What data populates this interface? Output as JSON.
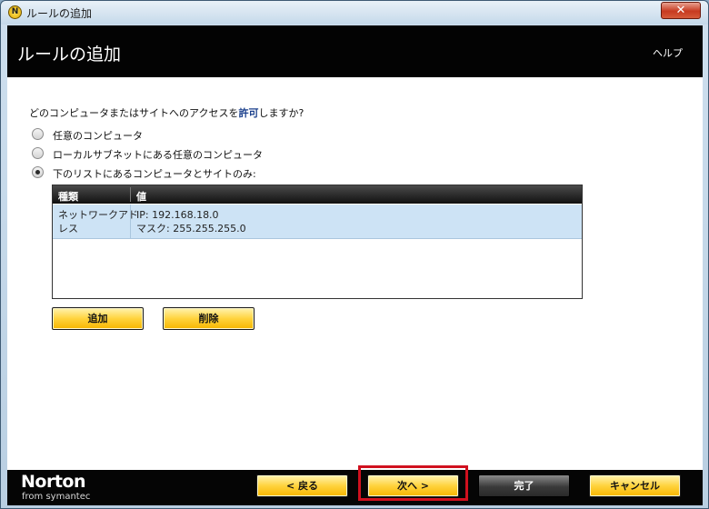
{
  "window": {
    "title": "ルールの追加",
    "app_icon_glyph": "N",
    "close_glyph": "✕"
  },
  "header": {
    "title": "ルールの追加",
    "help": "ヘルプ"
  },
  "question": {
    "prefix": "どのコンピュータまたはサイトへのアクセスを",
    "emphasis": "許可",
    "suffix": "しますか?"
  },
  "options": [
    {
      "label": "任意のコンピュータ",
      "checked": false
    },
    {
      "label": "ローカルサブネットにある任意のコンピュータ",
      "checked": false
    },
    {
      "label": "下のリストにあるコンピュータとサイトのみ:",
      "checked": true
    }
  ],
  "table": {
    "columns": [
      "種類",
      "値"
    ],
    "rows": [
      {
        "type_line1": "ネットワークアド",
        "type_line2": "レス",
        "value_line1": "IP: 192.168.18.0",
        "value_line2": "マスク: 255.255.255.0"
      }
    ]
  },
  "list_buttons": {
    "add": "追加",
    "delete": "削除"
  },
  "footer": {
    "brand": "Norton",
    "brand_sub": "from symantec",
    "back": "< 戻る",
    "next": "次へ >",
    "finish": "完了",
    "cancel": "キャンセル"
  },
  "colors": {
    "accent_button": "#ffd33d",
    "header_bg": "#030303",
    "selected_row": "#cde3f5",
    "highlight_box": "#d0101e"
  }
}
